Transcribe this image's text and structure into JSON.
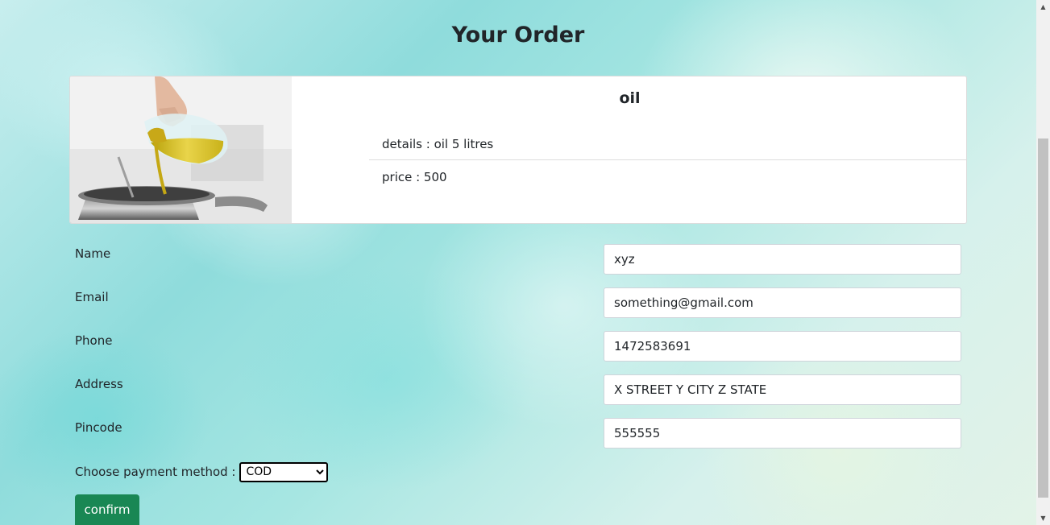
{
  "page": {
    "title": "Your Order"
  },
  "product": {
    "image_icon": "oil-pouring-photo",
    "name": "oil",
    "details": "details : oil 5 litres",
    "price": "price : 500"
  },
  "form": {
    "fields": [
      {
        "label": "Name",
        "value": "xyz"
      },
      {
        "label": "Email",
        "value": "something@gmail.com"
      },
      {
        "label": "Phone",
        "value": "1472583691"
      },
      {
        "label": "Address",
        "value": "X STREET Y CITY Z STATE"
      },
      {
        "label": "Pincode",
        "value": "555555"
      }
    ],
    "payment_label": "Choose payment method :",
    "payment_selected": "COD",
    "confirm_label": "confirm"
  },
  "colors": {
    "confirm_button": "#198754",
    "card_background": "#ffffff"
  },
  "scrollbar": {
    "up_icon": "scroll-up-arrow-icon",
    "down_icon": "scroll-down-arrow-icon"
  }
}
